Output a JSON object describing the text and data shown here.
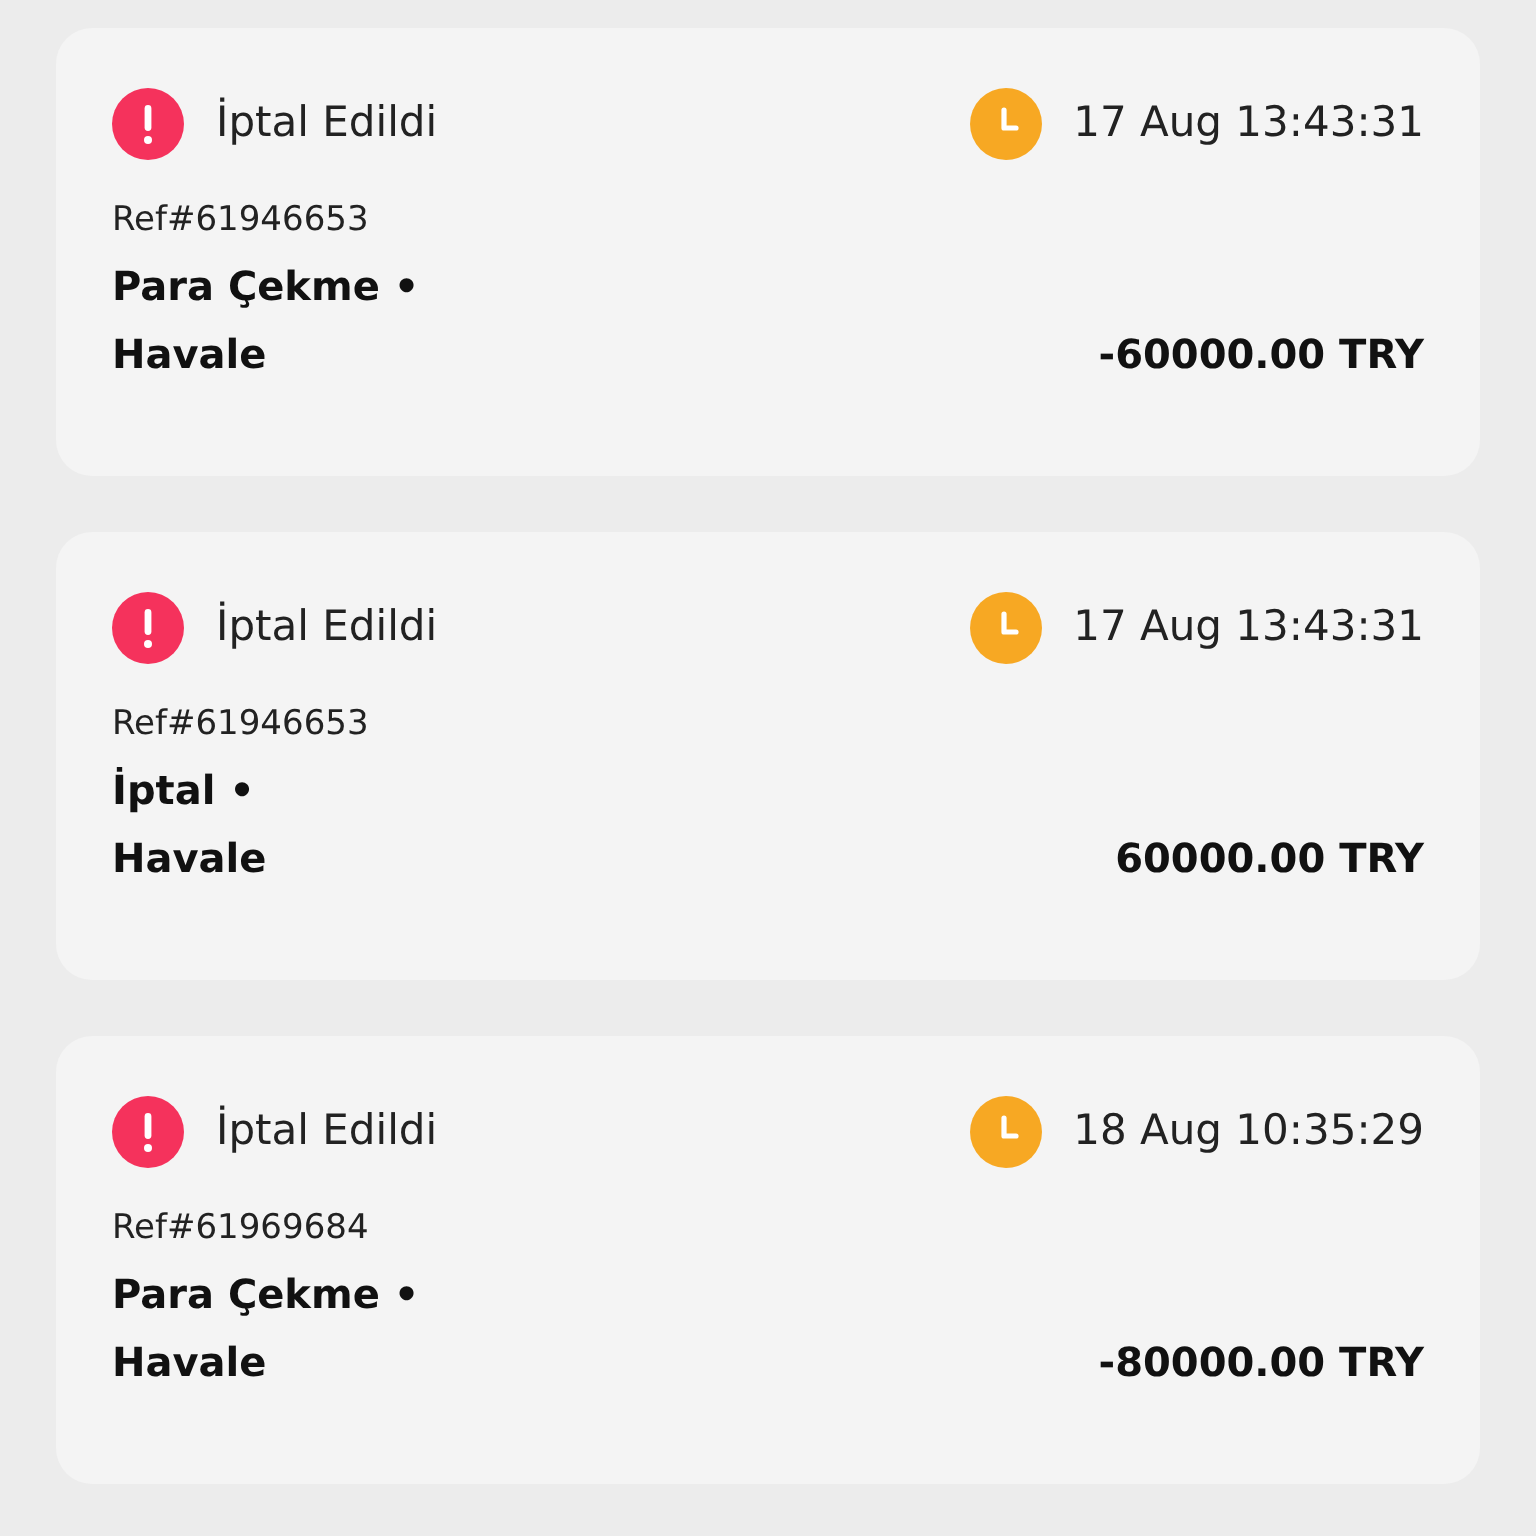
{
  "transactions": [
    {
      "status": "İptal Edildi",
      "time": "17 Aug 13:43:31",
      "ref": "Ref#61946653",
      "type": "Para Çekme •",
      "method": "Havale",
      "amount": "-60000.00 TRY"
    },
    {
      "status": "İptal Edildi",
      "time": "17 Aug 13:43:31",
      "ref": "Ref#61946653",
      "type": "İptal •",
      "method": "Havale",
      "amount": "60000.00 TRY"
    },
    {
      "status": "İptal Edildi",
      "time": "18 Aug 10:35:29",
      "ref": "Ref#61969684",
      "type": "Para Çekme •",
      "method": "Havale",
      "amount": "-80000.00 TRY"
    }
  ]
}
